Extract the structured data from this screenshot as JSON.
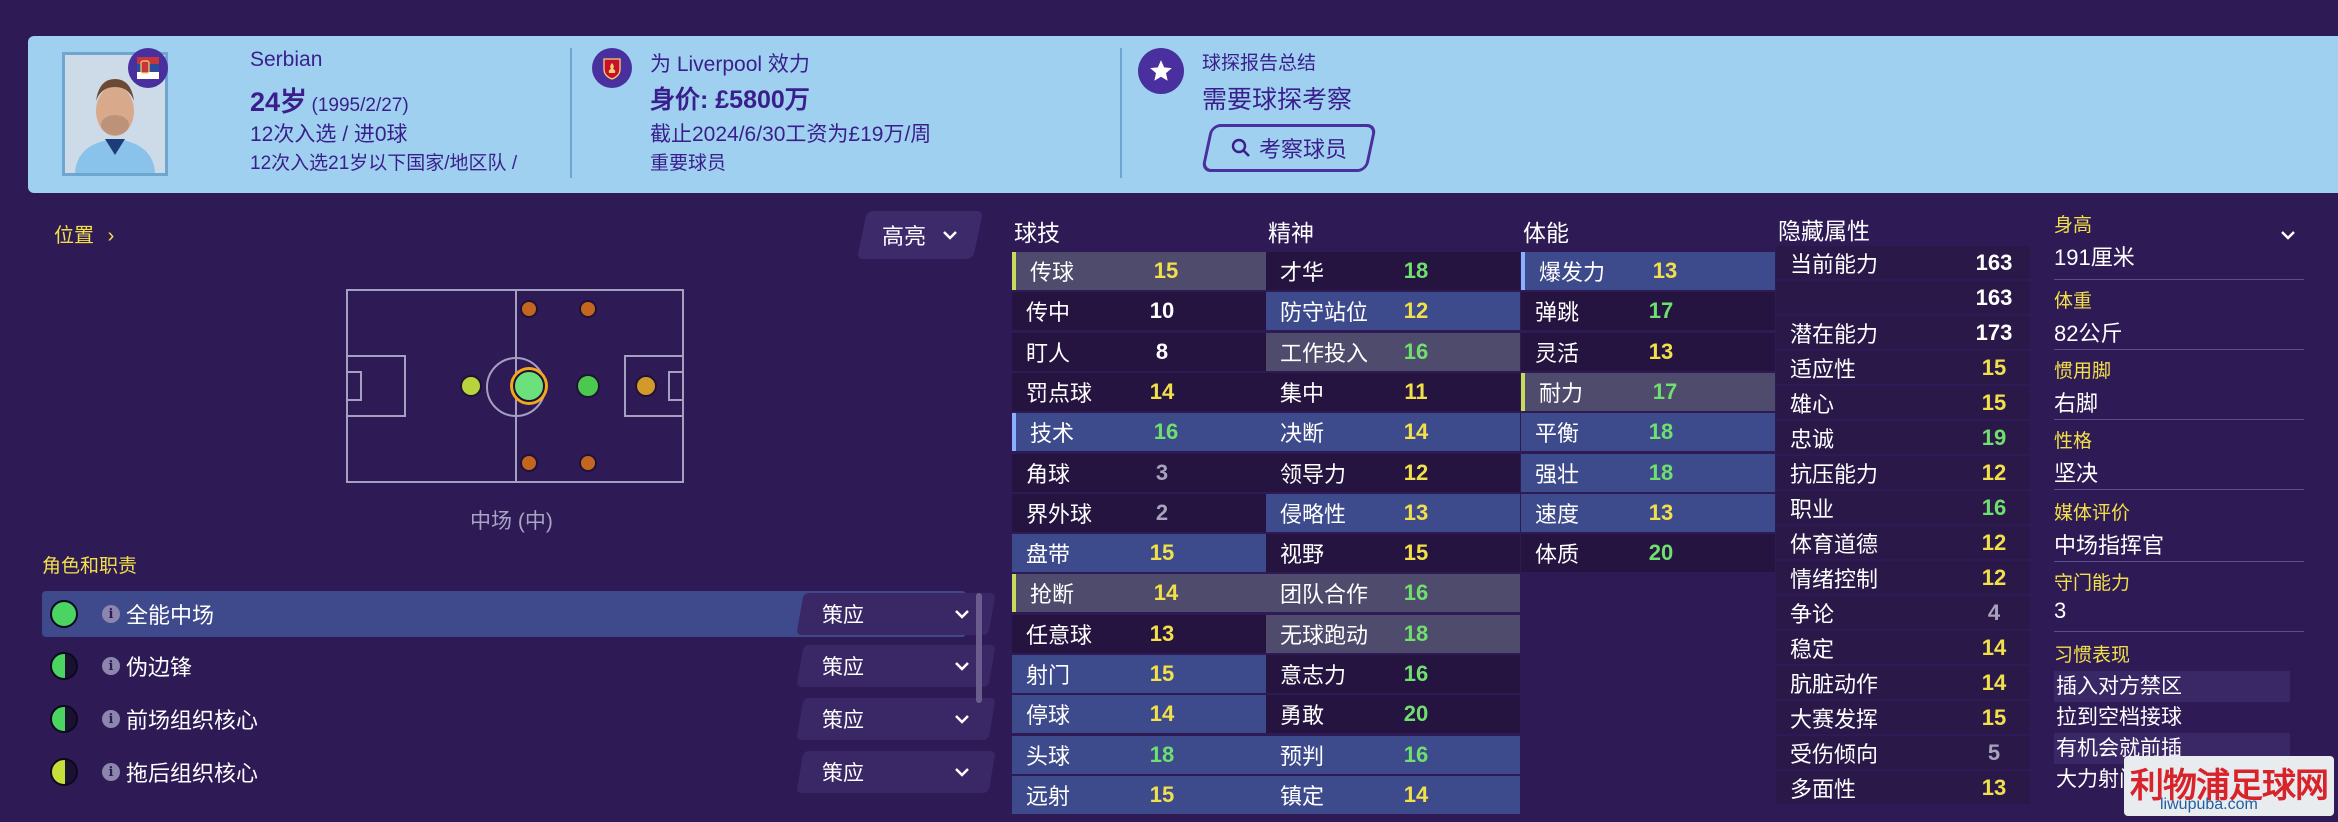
{
  "header": {
    "nation": "Serbian",
    "age": "24岁",
    "dob": "(1995/2/27)",
    "caps": "12次入选 / 进0球",
    "u21_caps": "12次入选21岁以下国家/地区队 /",
    "club_line": "为 Liverpool 效力",
    "value": "身价: £5800万",
    "contract": "截止2024/6/30工资为£19万/周",
    "squad_status": "重要球员",
    "scout_title": "球探报告总结",
    "scout_status": "需要球探考察",
    "scout_button": "考察球员"
  },
  "position": {
    "label": "位置",
    "highlight": "高亮",
    "current": "中场 (中)",
    "roles_title": "角色和职责"
  },
  "roles": [
    {
      "name": "全能中场",
      "duty": "策应",
      "color": "#4cd463"
    },
    {
      "name": "伪边锋",
      "duty": "策应",
      "color": "#4cd463"
    },
    {
      "name": "前场组织核心",
      "duty": "策应",
      "color": "#4cd463"
    },
    {
      "name": "拖后组织核心",
      "duty": "策应",
      "color": "#c6dd3a"
    }
  ],
  "technical": {
    "title": "球技",
    "items": [
      {
        "name": "传球",
        "value": "15"
      },
      {
        "name": "传中",
        "value": "10"
      },
      {
        "name": "盯人",
        "value": "8"
      },
      {
        "name": "罚点球",
        "value": "14"
      },
      {
        "name": "技术",
        "value": "16"
      },
      {
        "name": "角球",
        "value": "3"
      },
      {
        "name": "界外球",
        "value": "2"
      },
      {
        "name": "盘带",
        "value": "15"
      },
      {
        "name": "抢断",
        "value": "14"
      },
      {
        "name": "任意球",
        "value": "13"
      },
      {
        "name": "射门",
        "value": "15"
      },
      {
        "name": "停球",
        "value": "14"
      },
      {
        "name": "头球",
        "value": "18"
      },
      {
        "name": "远射",
        "value": "15"
      }
    ]
  },
  "mental": {
    "title": "精神",
    "items": [
      {
        "name": "才华",
        "value": "18"
      },
      {
        "name": "防守站位",
        "value": "12"
      },
      {
        "name": "工作投入",
        "value": "16"
      },
      {
        "name": "集中",
        "value": "11"
      },
      {
        "name": "决断",
        "value": "14"
      },
      {
        "name": "领导力",
        "value": "12"
      },
      {
        "name": "侵略性",
        "value": "13"
      },
      {
        "name": "视野",
        "value": "15"
      },
      {
        "name": "团队合作",
        "value": "16"
      },
      {
        "name": "无球跑动",
        "value": "18"
      },
      {
        "name": "意志力",
        "value": "16"
      },
      {
        "name": "勇敢",
        "value": "20"
      },
      {
        "name": "预判",
        "value": "16"
      },
      {
        "name": "镇定",
        "value": "14"
      }
    ]
  },
  "physical": {
    "title": "体能",
    "items": [
      {
        "name": "爆发力",
        "value": "13"
      },
      {
        "name": "弹跳",
        "value": "17"
      },
      {
        "name": "灵活",
        "value": "13"
      },
      {
        "name": "耐力",
        "value": "17"
      },
      {
        "name": "平衡",
        "value": "18"
      },
      {
        "name": "强壮",
        "value": "18"
      },
      {
        "name": "速度",
        "value": "13"
      },
      {
        "name": "体质",
        "value": "20"
      }
    ]
  },
  "hidden": {
    "title": "隐藏属性",
    "items": [
      {
        "name": "当前能力",
        "value": "163"
      },
      {
        "name": "",
        "value": "163"
      },
      {
        "name": "潜在能力",
        "value": "173"
      },
      {
        "name": "适应性",
        "value": "15"
      },
      {
        "name": "雄心",
        "value": "15"
      },
      {
        "name": "忠诚",
        "value": "19"
      },
      {
        "name": "抗压能力",
        "value": "12"
      },
      {
        "name": "职业",
        "value": "16"
      },
      {
        "name": "体育道德",
        "value": "12"
      },
      {
        "name": "情绪控制",
        "value": "12"
      },
      {
        "name": "争论",
        "value": "4"
      },
      {
        "name": "稳定",
        "value": "14"
      },
      {
        "name": "肮脏动作",
        "value": "14"
      },
      {
        "name": "大赛发挥",
        "value": "15"
      },
      {
        "name": "受伤倾向",
        "value": "5"
      },
      {
        "name": "多面性",
        "value": "13"
      }
    ]
  },
  "info": {
    "height_label": "身高",
    "height": "191厘米",
    "weight_label": "体重",
    "weight": "82公斤",
    "foot_label": "惯用脚",
    "foot": "右脚",
    "personality_label": "性格",
    "personality": "坚决",
    "media_label": "媒体评价",
    "media": "中场指挥官",
    "gk_label": "守门能力",
    "gk": "3",
    "habits_label": "习惯表现",
    "habits": [
      "插入对方禁区",
      "拉到空档接球",
      "有机会就前插",
      "大力射门"
    ]
  },
  "watermark": {
    "main": "利物浦足球网",
    "sub": "liwupuba.com"
  },
  "colors": {
    "header_bg": "#9fd0f0",
    "body_bg": "#2e1a55",
    "accent_yellow": "#f2e04a",
    "high_green": "#4cd463",
    "highlight_row": "#3e4a8c"
  }
}
